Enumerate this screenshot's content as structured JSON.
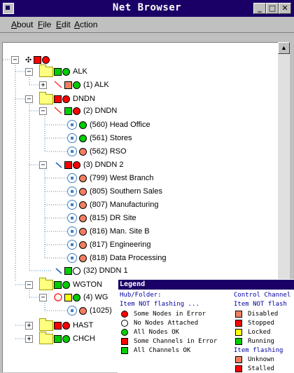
{
  "window": {
    "title": "Net Browser"
  },
  "menu": [
    {
      "label": "About",
      "mnemonic": "A",
      "rest": "bout"
    },
    {
      "label": "File",
      "mnemonic": "F",
      "rest": "ile"
    },
    {
      "label": "Edit",
      "mnemonic": "E",
      "rest": "dit"
    },
    {
      "label": "Action",
      "mnemonic": "A",
      "rest": "ction"
    }
  ],
  "tree": {
    "groups": [
      {
        "label": "ALK",
        "child": "(1)  ALK"
      },
      {
        "label": "DNDN",
        "hubs": [
          "(2)  DNDN",
          "(3)  DNDN  2",
          "(32)  DNDN 1"
        ],
        "nodes_hub2": [
          "(560) Head Office",
          "(561) Stores",
          "(562) RSO"
        ],
        "nodes_hub3": [
          "(799) West Branch",
          "(805) Southern Sales",
          "(807) Manufacturing",
          "(815) DR Site",
          "(816) Man. Site B",
          "(817) Engineering",
          "(818) Data Processing"
        ]
      },
      {
        "label": "WGTON",
        "hub": "(4)  WG",
        "node": "(1025)"
      },
      {
        "label": "HAST"
      },
      {
        "label": "CHCH"
      }
    ]
  },
  "legend": {
    "title": "Legend",
    "left_header": "Hub/Folder:",
    "left_subheader": "Item NOT flashing ...",
    "left_items": [
      {
        "shape": "dot",
        "color": "#ff0000",
        "text": "Some Nodes in Error"
      },
      {
        "shape": "dot",
        "color": "#ffffff",
        "text": "No Nodes Attached"
      },
      {
        "shape": "dot",
        "color": "#00cc00",
        "text": "All Nodes OK"
      },
      {
        "shape": "square",
        "color": "#ff0000",
        "text": "Some Channels in Error"
      },
      {
        "shape": "square",
        "color": "#00cc00",
        "text": "All Channels OK"
      }
    ],
    "right_header": "Control Channel",
    "right_subheader": "Item NOT flash",
    "right_items": [
      {
        "color": "#f08060",
        "text": "Disabled"
      },
      {
        "color": "#ff0000",
        "text": "Stopped"
      },
      {
        "color": "#ffff00",
        "text": "Locked"
      },
      {
        "color": "#00cc00",
        "text": "Running"
      }
    ],
    "right_subheader2": "Item flashing",
    "right_items2": [
      {
        "color": "#f08060",
        "text": "Unknown"
      },
      {
        "color": "#ff0000",
        "text": "Stalled"
      }
    ]
  },
  "colors": {
    "red": "#ff0000",
    "green": "#00cc00",
    "orange": "#f08060",
    "yellow": "#ffff00",
    "white": "#ffffff"
  },
  "icons": [
    "window-menu-icon",
    "minimize-icon",
    "maximize-icon",
    "close-icon",
    "folder-icon",
    "node-icon",
    "link-arrow-icon",
    "scroll-up-icon"
  ]
}
